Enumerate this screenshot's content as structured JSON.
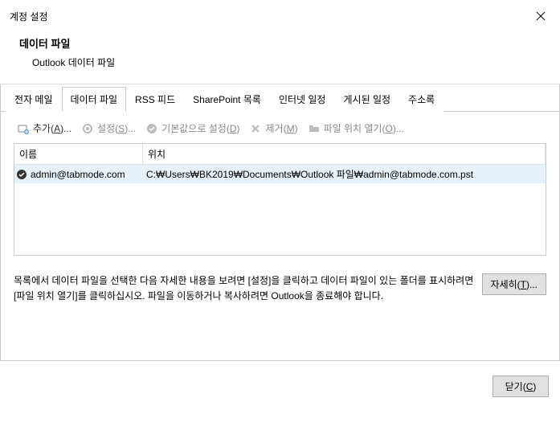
{
  "titlebar": {
    "title": "계정 설정"
  },
  "header": {
    "title": "데이터 파일",
    "subtitle": "Outlook 데이터 파일"
  },
  "tabs": {
    "items": [
      {
        "label": "전자 메일"
      },
      {
        "label": "데이터 파일"
      },
      {
        "label": "RSS 피드"
      },
      {
        "label": "SharePoint 목록"
      },
      {
        "label": "인터넷 일정"
      },
      {
        "label": "게시된 일정"
      },
      {
        "label": "주소록"
      }
    ],
    "activeIndex": 1
  },
  "toolbar": {
    "add_pre": "추가(",
    "add_u": "A",
    "add_post": ")...",
    "settings_pre": "설정(",
    "settings_u": "S",
    "settings_post": ")...",
    "default_pre": "기본값으로 설정(",
    "default_u": "D",
    "default_post": ")",
    "remove_pre": "제거(",
    "remove_u": "M",
    "remove_post": ")",
    "open_pre": "파일 위치 열기(",
    "open_u": "O",
    "open_post": ")..."
  },
  "list": {
    "cols": {
      "name": "이름",
      "location": "위치"
    },
    "rows": [
      {
        "name": "admin@tabmode.com",
        "location": "C:₩Users₩BK2019₩Documents₩Outlook 파일₩admin@tabmode.com.pst",
        "default": true,
        "selected": true
      }
    ]
  },
  "info": {
    "text": "목록에서 데이터 파일을 선택한 다음 자세한 내용을 보려면 [설정]을 클릭하고 데이터 파일이 있는 폴더를 표시하려면 [파일 위치 열기]를 클릭하십시오. 파일을 이동하거나 복사하려면 Outlook을 종료해야 합니다.",
    "details_pre": "자세히(",
    "details_u": "T",
    "details_post": ")..."
  },
  "footer": {
    "close_pre": "닫기(",
    "close_u": "C",
    "close_post": ")"
  }
}
